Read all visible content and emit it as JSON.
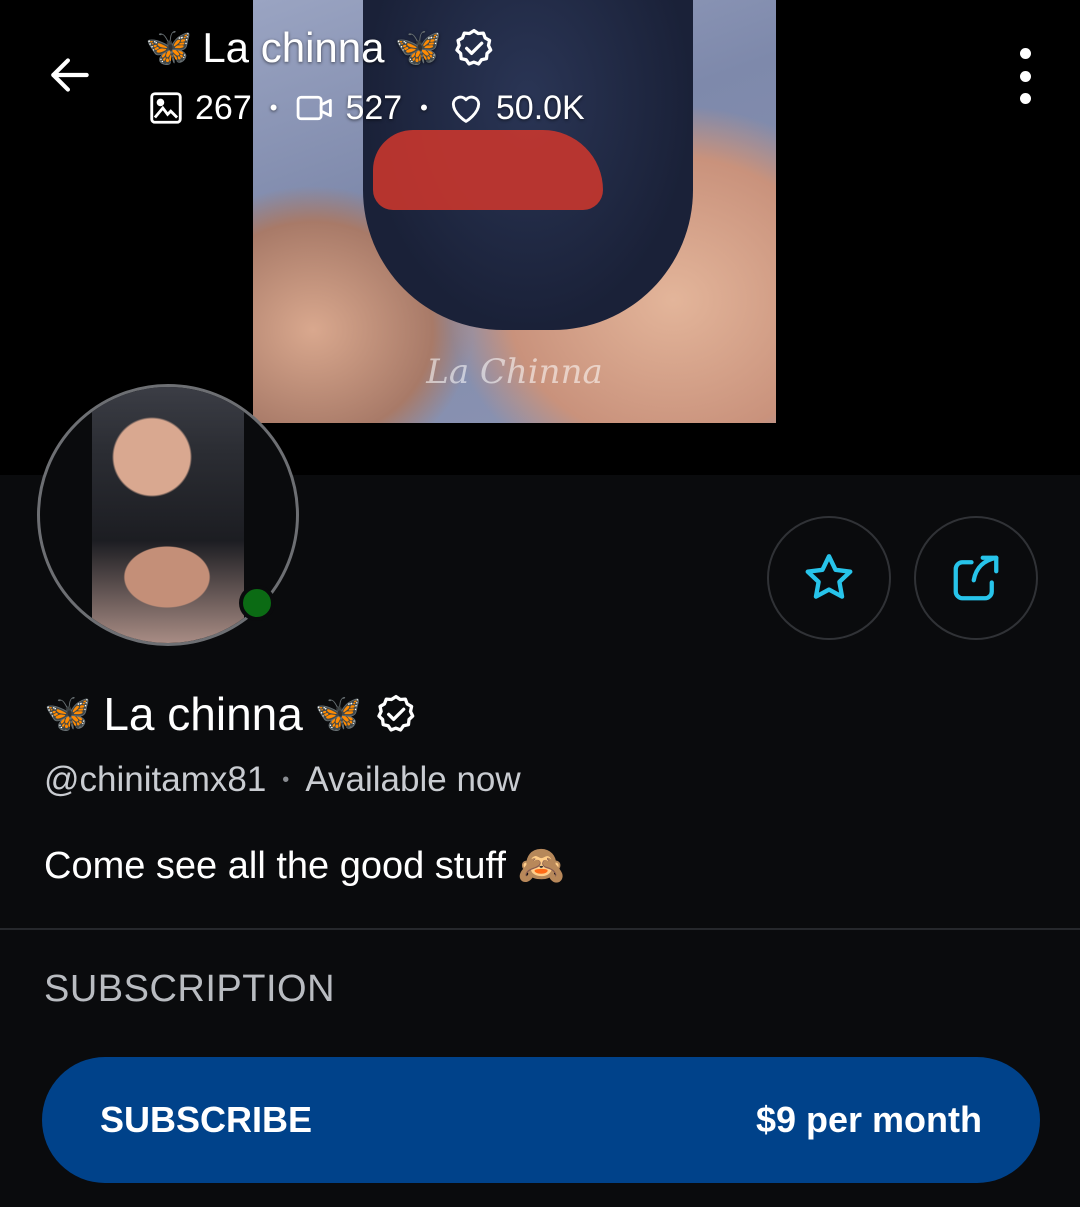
{
  "header": {
    "title": "La chinna",
    "emoji_left": "🦋",
    "emoji_right": "🦋",
    "verified_icon": "verified-badge-icon",
    "stats": {
      "photos": "267",
      "videos": "527",
      "likes": "50.0K"
    },
    "separator": "•"
  },
  "cover": {
    "watermark": "La Chinna"
  },
  "actions": {
    "favorite_icon": "star-icon",
    "share_icon": "share-icon"
  },
  "profile": {
    "name": "La chinna",
    "emoji_left": "🦋",
    "emoji_right": "🦋",
    "handle": "@chinitamx81",
    "status": "Available now",
    "separator": "•",
    "bio": "Come see all the good stuff",
    "bio_emoji": "🙈",
    "online": true
  },
  "subscription": {
    "heading": "SUBSCRIPTION",
    "button_label": "SUBSCRIBE",
    "price": "$9 per month"
  },
  "colors": {
    "background": "#0a0b0d",
    "accent": "#27c4ea",
    "subscribe_button": "#00428a",
    "online": "#0b6b14"
  }
}
